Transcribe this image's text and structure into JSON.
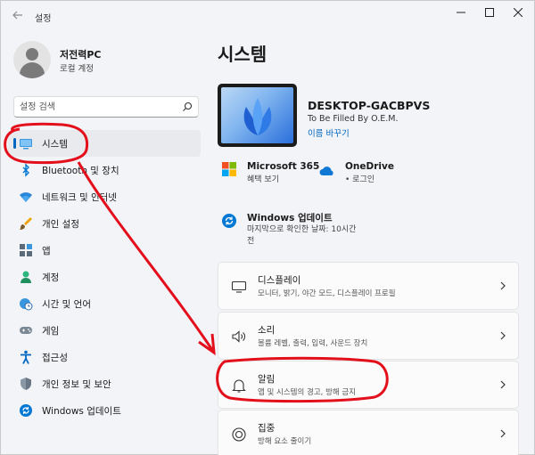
{
  "window": {
    "title": "설정",
    "back_icon": "back-arrow-icon",
    "controls": {
      "minimize": "—",
      "maximize": "☐",
      "close": "✕"
    }
  },
  "user": {
    "name": "저전력PC",
    "account_type": "로컬 계정",
    "avatar_icon": "person-icon"
  },
  "search": {
    "placeholder": "설정 검색",
    "icon": "search-icon"
  },
  "sidebar": {
    "items": [
      {
        "label": "시스템",
        "icon": "monitor-icon",
        "active": true
      },
      {
        "label": "Bluetooth 및 장치",
        "icon": "bluetooth-icon"
      },
      {
        "label": "네트워크 및 인터넷",
        "icon": "wifi-icon"
      },
      {
        "label": "개인 설정",
        "icon": "brush-icon"
      },
      {
        "label": "앱",
        "icon": "apps-icon"
      },
      {
        "label": "계정",
        "icon": "account-icon"
      },
      {
        "label": "시간 및 언어",
        "icon": "globe-clock-icon"
      },
      {
        "label": "게임",
        "icon": "gamepad-icon"
      },
      {
        "label": "접근성",
        "icon": "accessibility-icon"
      },
      {
        "label": "개인 정보 및 보안",
        "icon": "shield-icon"
      },
      {
        "label": "Windows 업데이트",
        "icon": "update-icon"
      }
    ]
  },
  "main": {
    "title": "시스템",
    "device": {
      "name": "DESKTOP-GACBPVS",
      "manufacturer": "To Be Filled By O.E.M.",
      "rename_label": "이름 바꾸기"
    },
    "tiles": {
      "microsoft365": {
        "title": "Microsoft 365",
        "subtitle": "혜택 보기",
        "icon": "microsoft-logo-icon"
      },
      "onedrive": {
        "title": "OneDrive",
        "subtitle": "• 로그인",
        "icon": "cloud-icon"
      },
      "windows_update": {
        "title": "Windows 업데이트",
        "subtitle_line1": "마지막으로 확인한 날짜: 10시간",
        "subtitle_line2": "전",
        "icon": "update-icon"
      }
    },
    "cards": [
      {
        "title": "디스플레이",
        "subtitle": "모니터, 밝기, 야간 모드, 디스플레이 프로필",
        "icon": "display-icon"
      },
      {
        "title": "소리",
        "subtitle": "볼륨 레벨, 출력, 입력, 사운드 장치",
        "icon": "speaker-icon"
      },
      {
        "title": "알림",
        "subtitle": "앱 및 시스템의 경고, 방해 금지",
        "icon": "bell-icon"
      },
      {
        "title": "집중",
        "subtitle": "방해 요소 줄이기",
        "icon": "focus-icon"
      }
    ]
  },
  "colors": {
    "accent": "#0067c0",
    "annotation": "#e3101c",
    "background": "#f3f4f8"
  }
}
